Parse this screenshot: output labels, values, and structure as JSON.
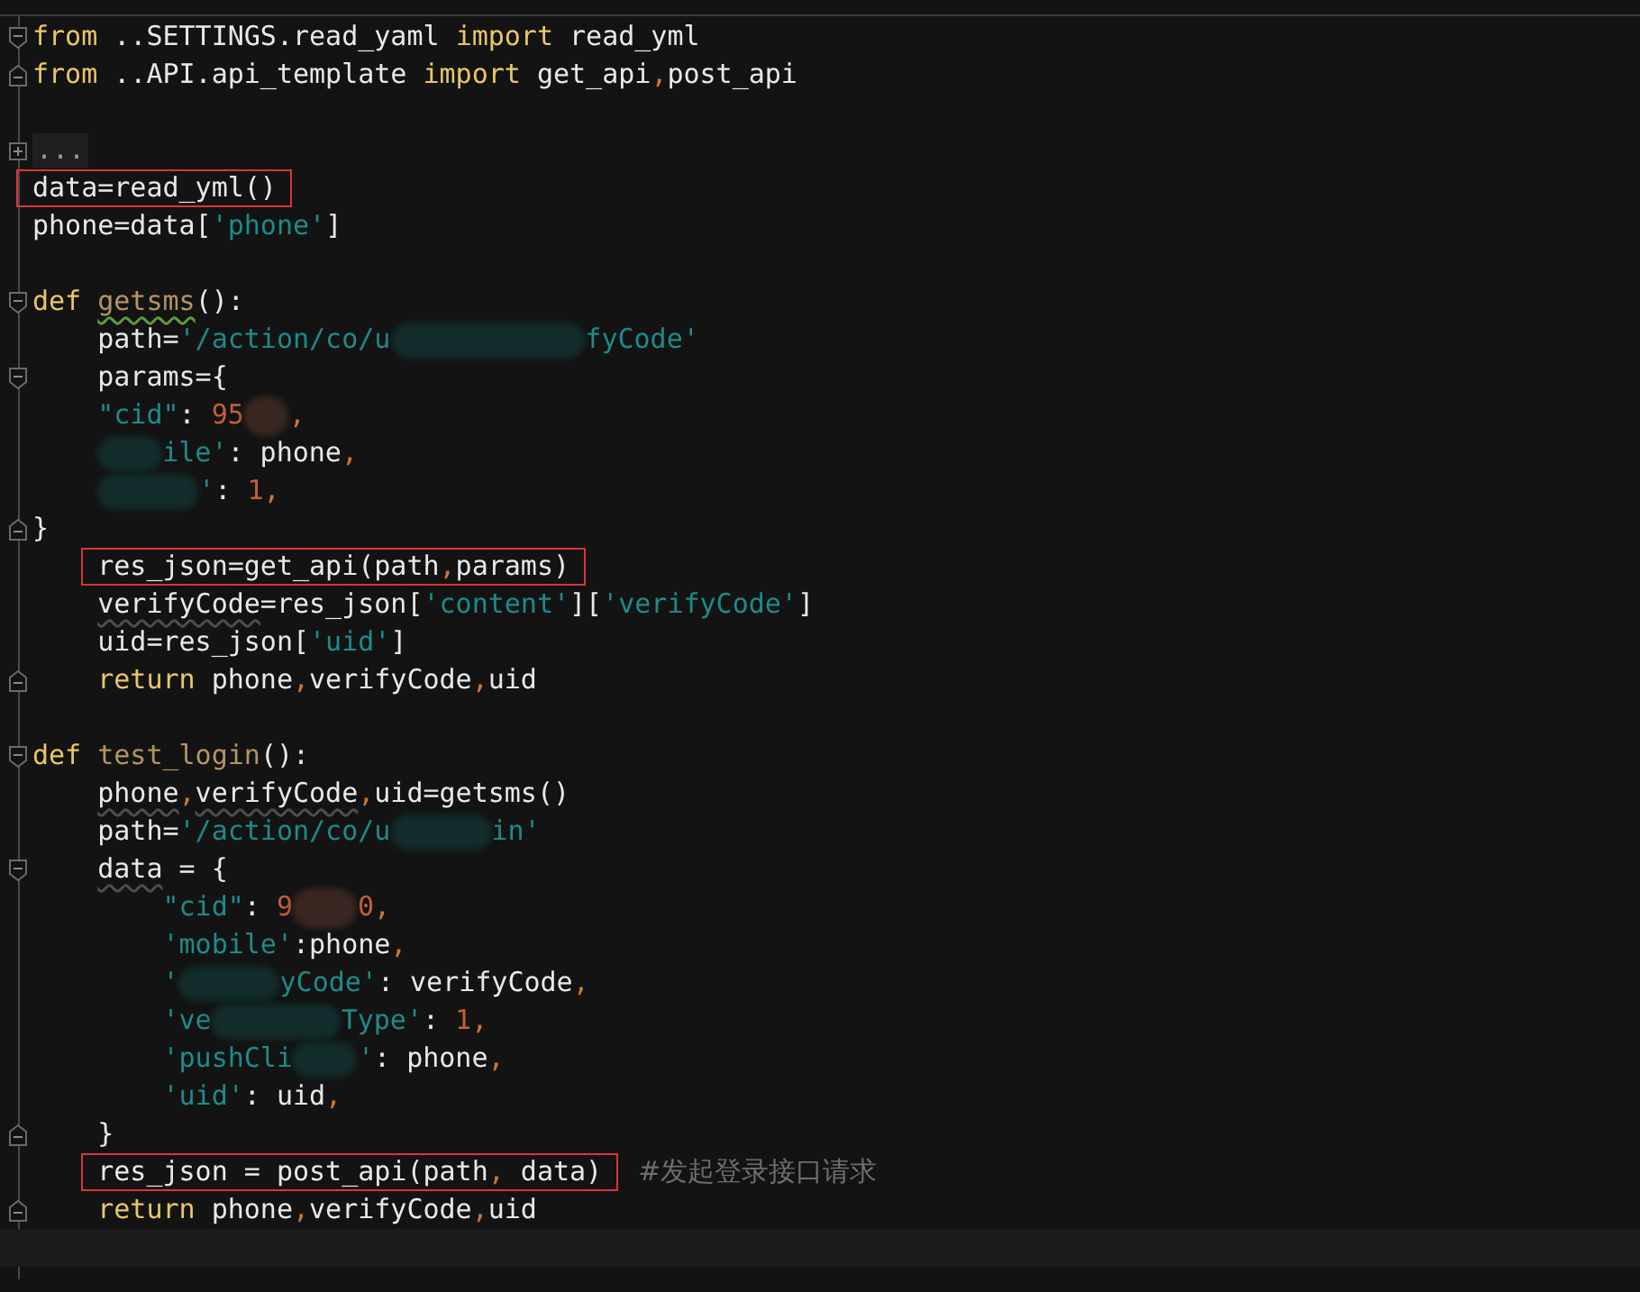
{
  "editor": {
    "lines": [
      {
        "kind": "fold-open",
        "segments": [
          {
            "kind": "code",
            "boxed": false,
            "tokens": [
              {
                "kind": "kw",
                "text": "from"
              },
              {
                "kind": "plain",
                "text": " ..SETTINGS.read_yaml "
              },
              {
                "kind": "kw",
                "text": "import"
              },
              {
                "kind": "plain",
                "text": " read_yml"
              }
            ]
          }
        ]
      },
      {
        "kind": "fold-close",
        "segments": [
          {
            "kind": "code",
            "boxed": false,
            "tokens": [
              {
                "kind": "kw",
                "text": "from"
              },
              {
                "kind": "plain",
                "text": " ..API.api_template "
              },
              {
                "kind": "kw",
                "text": "import"
              },
              {
                "kind": "plain",
                "text": " get_api"
              },
              {
                "kind": "punct",
                "text": ","
              },
              {
                "kind": "plain",
                "text": "post_api"
              }
            ]
          }
        ]
      },
      {
        "kind": "plain"
      },
      {
        "kind": "folded",
        "segments": [
          {
            "kind": "folded",
            "text": "..."
          }
        ]
      },
      {
        "kind": "plain",
        "segments": [
          {
            "kind": "code",
            "boxed": true,
            "tokens": [
              {
                "kind": "plain",
                "text": "data=read_yml()"
              }
            ]
          }
        ]
      },
      {
        "kind": "plain",
        "segments": [
          {
            "kind": "code",
            "boxed": false,
            "tokens": [
              {
                "kind": "plain",
                "text": "phone=data["
              },
              {
                "kind": "str",
                "text": "'phone'"
              },
              {
                "kind": "plain",
                "text": "]"
              }
            ]
          }
        ]
      },
      {
        "kind": "plain"
      },
      {
        "kind": "fold-open",
        "segments": [
          {
            "kind": "code",
            "boxed": false,
            "tokens": [
              {
                "kind": "kw",
                "text": "def "
              },
              {
                "kind": "misspelled",
                "text": "getsms"
              },
              {
                "kind": "plain",
                "text": "():"
              }
            ]
          }
        ]
      },
      {
        "kind": "plain",
        "segments": [
          {
            "kind": "code",
            "boxed": false,
            "tokens": [
              {
                "kind": "plain",
                "text": "    path="
              },
              {
                "kind": "str",
                "text": "'/action/co/u"
              }
            ]
          },
          {
            "kind": "smear-huge"
          },
          {
            "kind": "code",
            "boxed": false,
            "tokens": [
              {
                "kind": "str",
                "text": "fyCode'"
              }
            ]
          }
        ]
      },
      {
        "kind": "fold-open",
        "segments": [
          {
            "kind": "code",
            "boxed": false,
            "tokens": [
              {
                "kind": "plain",
                "text": "    params={"
              }
            ]
          }
        ]
      },
      {
        "kind": "plain",
        "segments": [
          {
            "kind": "code",
            "boxed": false,
            "tokens": [
              {
                "kind": "str",
                "text": "    \"cid\""
              },
              {
                "kind": "plain",
                "text": ": "
              },
              {
                "kind": "num",
                "text": "95"
              }
            ]
          },
          {
            "kind": "stain-tiny"
          },
          {
            "kind": "code",
            "boxed": false,
            "tokens": [
              {
                "kind": "punct",
                "text": ","
              }
            ]
          }
        ]
      },
      {
        "kind": "plain",
        "segments": [
          {
            "kind": "smear-small-indented"
          },
          {
            "kind": "code",
            "boxed": false,
            "tokens": [
              {
                "kind": "str",
                "text": "ile'"
              },
              {
                "kind": "plain",
                "text": ": phone"
              },
              {
                "kind": "punct",
                "text": ","
              }
            ]
          }
        ]
      },
      {
        "kind": "plain",
        "segments": [
          {
            "kind": "smear-medium-indented"
          },
          {
            "kind": "code",
            "boxed": false,
            "tokens": [
              {
                "kind": "str",
                "text": "'"
              },
              {
                "kind": "plain",
                "text": ": "
              },
              {
                "kind": "num",
                "text": "1"
              },
              {
                "kind": "punct",
                "text": ","
              }
            ]
          }
        ]
      },
      {
        "kind": "fold-close",
        "segments": [
          {
            "kind": "code",
            "boxed": false,
            "tokens": [
              {
                "kind": "plain",
                "text": "}"
              }
            ]
          }
        ]
      },
      {
        "kind": "plain",
        "segments": [
          {
            "kind": "code",
            "boxed": true,
            "tokens": [
              {
                "kind": "plain",
                "text": "    res_json=get_api(path"
              },
              {
                "kind": "punct",
                "text": ","
              },
              {
                "kind": "plain",
                "text": "params)"
              }
            ]
          }
        ]
      },
      {
        "kind": "plain",
        "segments": [
          {
            "kind": "code",
            "boxed": false,
            "tokens": [
              {
                "kind": "flagged",
                "text": "    verifyCode"
              },
              {
                "kind": "plain",
                "text": "=res_json["
              },
              {
                "kind": "str",
                "text": "'content'"
              },
              {
                "kind": "plain",
                "text": "]["
              },
              {
                "kind": "str",
                "text": "'verifyCode'"
              },
              {
                "kind": "plain",
                "text": "]"
              }
            ]
          }
        ]
      },
      {
        "kind": "plain",
        "segments": [
          {
            "kind": "code",
            "boxed": false,
            "tokens": [
              {
                "kind": "plain",
                "text": "    uid=res_json["
              },
              {
                "kind": "str",
                "text": "'uid'"
              },
              {
                "kind": "plain",
                "text": "]"
              }
            ]
          }
        ]
      },
      {
        "kind": "fold-close",
        "segments": [
          {
            "kind": "code",
            "boxed": false,
            "tokens": [
              {
                "kind": "kw",
                "text": "    return"
              },
              {
                "kind": "plain",
                "text": " phone"
              },
              {
                "kind": "punct",
                "text": ","
              },
              {
                "kind": "plain",
                "text": "verifyCode"
              },
              {
                "kind": "punct",
                "text": ","
              },
              {
                "kind": "plain",
                "text": "uid"
              }
            ]
          }
        ]
      },
      {
        "kind": "plain"
      },
      {
        "kind": "fold-open",
        "segments": [
          {
            "kind": "code",
            "boxed": false,
            "tokens": [
              {
                "kind": "kw",
                "text": "def "
              },
              {
                "kind": "fn",
                "text": "test_login"
              },
              {
                "kind": "plain",
                "text": "():"
              }
            ]
          }
        ]
      },
      {
        "kind": "plain",
        "segments": [
          {
            "kind": "code",
            "boxed": false,
            "tokens": [
              {
                "kind": "flagged",
                "text": "    phone"
              },
              {
                "kind": "punct",
                "text": ","
              },
              {
                "kind": "flagged",
                "text": "verifyCode"
              },
              {
                "kind": "punct",
                "text": ","
              },
              {
                "kind": "plain",
                "text": "uid=getsms()"
              }
            ]
          }
        ]
      },
      {
        "kind": "plain",
        "segments": [
          {
            "kind": "code",
            "boxed": false,
            "tokens": [
              {
                "kind": "plain",
                "text": "    path="
              },
              {
                "kind": "str",
                "text": "'/action/co/u"
              }
            ]
          },
          {
            "kind": "smear-medium"
          },
          {
            "kind": "code",
            "boxed": false,
            "tokens": [
              {
                "kind": "str",
                "text": "in'"
              }
            ]
          }
        ]
      },
      {
        "kind": "fold-open",
        "segments": [
          {
            "kind": "code",
            "boxed": false,
            "tokens": [
              {
                "kind": "flagged",
                "text": "    data"
              },
              {
                "kind": "plain",
                "text": " = {"
              }
            ]
          }
        ]
      },
      {
        "kind": "plain",
        "segments": [
          {
            "kind": "code",
            "boxed": false,
            "tokens": [
              {
                "kind": "str",
                "text": "        \"cid\""
              },
              {
                "kind": "plain",
                "text": ": "
              },
              {
                "kind": "num",
                "text": "9"
              }
            ]
          },
          {
            "kind": "stain-small"
          },
          {
            "kind": "code",
            "boxed": false,
            "tokens": [
              {
                "kind": "num",
                "text": "0"
              },
              {
                "kind": "punct",
                "text": ","
              }
            ]
          }
        ]
      },
      {
        "kind": "plain",
        "segments": [
          {
            "kind": "code",
            "boxed": false,
            "tokens": [
              {
                "kind": "str",
                "text": "        'mobile'"
              },
              {
                "kind": "plain",
                "text": ":phone"
              },
              {
                "kind": "punct",
                "text": ","
              }
            ]
          }
        ]
      },
      {
        "kind": "plain",
        "segments": [
          {
            "kind": "code",
            "boxed": false,
            "tokens": [
              {
                "kind": "str",
                "text": "        '"
              }
            ]
          },
          {
            "kind": "smear-medium"
          },
          {
            "kind": "code",
            "boxed": false,
            "tokens": [
              {
                "kind": "str",
                "text": "yCode'"
              },
              {
                "kind": "plain",
                "text": ": verifyCode"
              },
              {
                "kind": "punct",
                "text": ","
              }
            ]
          }
        ]
      },
      {
        "kind": "plain",
        "segments": [
          {
            "kind": "code",
            "boxed": false,
            "tokens": [
              {
                "kind": "str",
                "text": "        've"
              }
            ]
          },
          {
            "kind": "smear-large"
          },
          {
            "kind": "code",
            "boxed": false,
            "tokens": [
              {
                "kind": "str",
                "text": "Type'"
              },
              {
                "kind": "plain",
                "text": ": "
              },
              {
                "kind": "num",
                "text": "1"
              },
              {
                "kind": "punct",
                "text": ","
              }
            ]
          }
        ]
      },
      {
        "kind": "plain",
        "segments": [
          {
            "kind": "code",
            "boxed": false,
            "tokens": [
              {
                "kind": "str",
                "text": "        'pushCli"
              }
            ]
          },
          {
            "kind": "smear-small"
          },
          {
            "kind": "code",
            "boxed": false,
            "tokens": [
              {
                "kind": "str",
                "text": "'"
              },
              {
                "kind": "plain",
                "text": ": phone"
              },
              {
                "kind": "punct",
                "text": ","
              }
            ]
          }
        ]
      },
      {
        "kind": "plain",
        "segments": [
          {
            "kind": "code",
            "boxed": false,
            "tokens": [
              {
                "kind": "str",
                "text": "        'uid'"
              },
              {
                "kind": "plain",
                "text": ": uid"
              },
              {
                "kind": "punct",
                "text": ","
              }
            ]
          }
        ]
      },
      {
        "kind": "fold-close",
        "segments": [
          {
            "kind": "code",
            "boxed": false,
            "tokens": [
              {
                "kind": "plain",
                "text": "    }"
              }
            ]
          }
        ]
      },
      {
        "kind": "plain",
        "segments": [
          {
            "kind": "code",
            "boxed": true,
            "tokens": [
              {
                "kind": "plain",
                "text": "    res_json = post_api(path"
              },
              {
                "kind": "punct",
                "text": ","
              },
              {
                "kind": "plain",
                "text": " data)"
              }
            ]
          },
          {
            "kind": "comment",
            "text": "#发起登录接口请求"
          }
        ]
      },
      {
        "kind": "fold-close",
        "segments": [
          {
            "kind": "code",
            "boxed": false,
            "tokens": [
              {
                "kind": "kw",
                "text": "    return"
              },
              {
                "kind": "plain",
                "text": " phone"
              },
              {
                "kind": "punct",
                "text": ","
              },
              {
                "kind": "plain",
                "text": "verifyCode"
              },
              {
                "kind": "punct",
                "text": ","
              },
              {
                "kind": "plain",
                "text": "uid"
              }
            ]
          }
        ]
      },
      {
        "kind": "caret"
      }
    ]
  }
}
